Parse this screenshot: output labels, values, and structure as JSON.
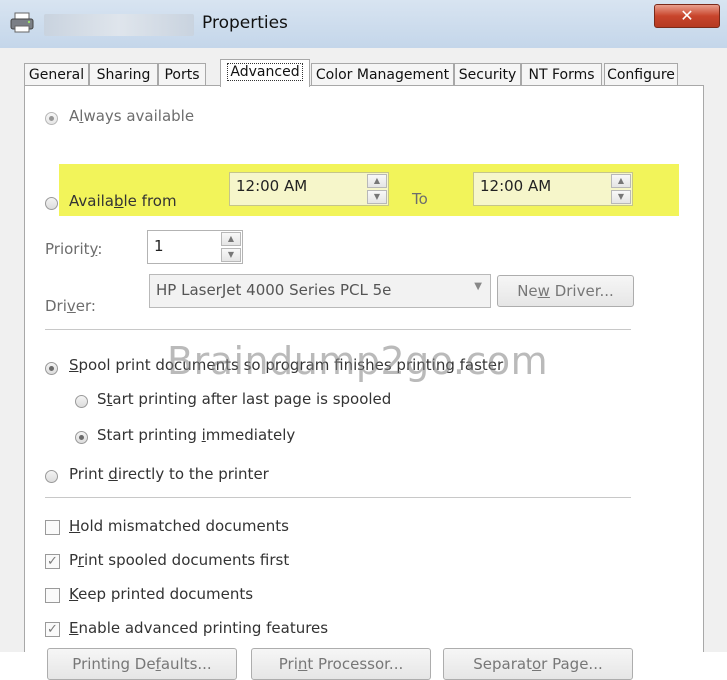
{
  "window": {
    "title": "Properties",
    "close_glyph": "✕"
  },
  "tabs": [
    {
      "label": "General"
    },
    {
      "label": "Sharing"
    },
    {
      "label": "Ports"
    },
    {
      "label": "Advanced"
    },
    {
      "label": "Color Management"
    },
    {
      "label": "Security"
    },
    {
      "label": "NT Forms"
    },
    {
      "label": "Configure"
    }
  ],
  "availability": {
    "always_label_prefix": "A",
    "always_label_underlined": "l",
    "always_label_suffix": "ways available",
    "from_label_prefix": "Availa",
    "from_label_underlined": "b",
    "from_label_suffix": "le from",
    "from_time": "12:00 AM",
    "to_label": "To",
    "to_time": "12:00 AM"
  },
  "priority": {
    "label_prefix": "Priorit",
    "label_underlined": "y",
    "label_suffix": ":",
    "value": "1"
  },
  "driver": {
    "label_prefix": "Dri",
    "label_underlined": "v",
    "label_suffix": "er:",
    "selected": "HP LaserJet 4000 Series PCL 5e",
    "new_driver_prefix": "Ne",
    "new_driver_underlined": "w",
    "new_driver_suffix": " Driver..."
  },
  "spooling": {
    "spool_prefix": "",
    "spool_underlined": "S",
    "spool_suffix": "pool print documents so program finishes printing faster",
    "after_last_prefix": "S",
    "after_last_underlined": "t",
    "after_last_suffix": "art printing after last page is spooled",
    "immediately_prefix": "Start printing ",
    "immediately_underlined": "i",
    "immediately_suffix": "mmediately",
    "direct_prefix": "Print ",
    "direct_underlined": "d",
    "direct_suffix": "irectly to the printer"
  },
  "options": {
    "hold_prefix": "",
    "hold_underlined": "H",
    "hold_suffix": "old mismatched documents",
    "spooled_first_prefix": "P",
    "spooled_first_underlined": "r",
    "spooled_first_suffix": "int spooled documents first",
    "keep_prefix": "",
    "keep_underlined": "K",
    "keep_suffix": "eep printed documents",
    "enable_prefix": "",
    "enable_underlined": "E",
    "enable_suffix": "nable advanced printing features"
  },
  "buttons": {
    "defaults_prefix": "Printing De",
    "defaults_underlined": "f",
    "defaults_suffix": "aults...",
    "processor_prefix": "Pri",
    "processor_underlined": "n",
    "processor_suffix": "t Processor...",
    "separator_prefix": "Separat",
    "separator_underlined": "o",
    "separator_suffix": "r Page..."
  },
  "watermark": "Braindump2go.com",
  "colors": {
    "highlight": "#f2f45a",
    "titlebar": "#c4d6ea",
    "close_button": "#c8452c"
  }
}
